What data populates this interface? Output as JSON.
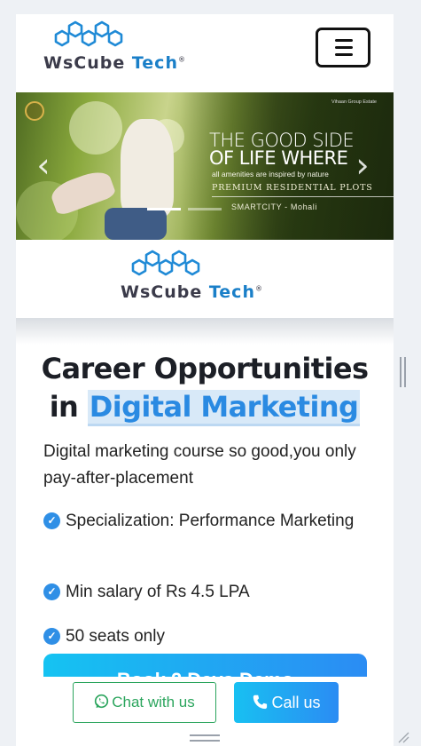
{
  "header": {
    "logo": {
      "word1": "WsCube",
      "word2": "Tech",
      "mark": "®"
    },
    "menu_icon": "hamburger-menu-icon"
  },
  "banner": {
    "headline_line1": "THE GOOD SIDE",
    "headline_line2": "OF LIFE WHERE",
    "tagline": "all amenities are inspired by nature",
    "product": "PREMIUM RESIDENTIAL PLOTS",
    "location": "SMARTCITY - Mohali",
    "small_note": "Vihaan Group Estate",
    "prev_icon": "chevron-left-icon",
    "next_icon": "chevron-right-icon",
    "slides_total": 2,
    "active_slide": 1
  },
  "promo_logo": {
    "word1": "WsCube",
    "word2": "Tech",
    "mark": "®"
  },
  "main": {
    "headline_part1": "Career Opportunities",
    "headline_in": "in",
    "headline_highlight": "Digital Marketing",
    "description": "Digital marketing course so good,you only pay-after-placement",
    "features": [
      "Specialization: Performance Marketing",
      "Min salary of Rs 4.5 LPA",
      "50 seats only"
    ],
    "cta_label": "Book 2 Days Demo"
  },
  "footer": {
    "whatsapp_label": "Chat with us",
    "call_label": "Call us",
    "whatsapp_icon": "whatsapp-icon",
    "call_icon": "phone-icon"
  },
  "colors": {
    "brand_blue": "#1a7fc8",
    "accent_blue": "#2a8ae2",
    "whatsapp_green": "#2ba55d",
    "cta_gradient_start": "#15c3f2",
    "cta_gradient_end": "#2b8cf3"
  }
}
